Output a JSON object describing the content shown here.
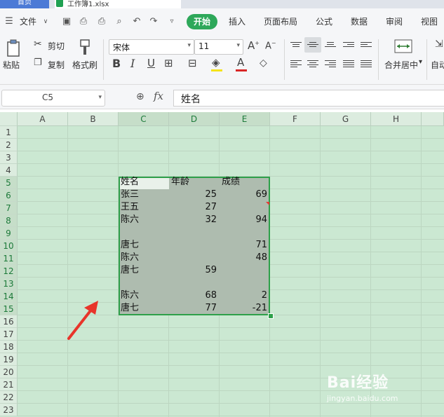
{
  "tabs": {
    "home": "首页",
    "file": "工作簿1.xlsx"
  },
  "menu": {
    "file": "文件",
    "items": [
      "开始",
      "插入",
      "页面布局",
      "公式",
      "数据",
      "审阅",
      "视图"
    ]
  },
  "ribbon": {
    "paste": "粘贴",
    "cut": "剪切",
    "copy": "复制",
    "format_painter": "格式刷",
    "font_name": "宋体",
    "font_size": "11",
    "merge_center": "合并居中",
    "auto": "自动"
  },
  "formula_bar": {
    "cell_ref": "C5",
    "fx": "fx",
    "content": "姓名"
  },
  "columns": [
    "A",
    "B",
    "C",
    "D",
    "E",
    "F",
    "G",
    "H"
  ],
  "rows": [
    "1",
    "2",
    "3",
    "4",
    "5",
    "6",
    "7",
    "8",
    "9",
    "10",
    "11",
    "12",
    "13",
    "14",
    "15",
    "16",
    "17",
    "18",
    "19",
    "20",
    "21",
    "22",
    "23"
  ],
  "table": [
    [
      "姓名",
      "年龄",
      "成绩"
    ],
    [
      "张三",
      "25",
      "69"
    ],
    [
      "王五",
      "27",
      ""
    ],
    [
      "陈六",
      "32",
      "94"
    ],
    [
      "",
      "",
      ""
    ],
    [
      "唐七",
      "",
      "71"
    ],
    [
      "陈六",
      "",
      "48"
    ],
    [
      "唐七",
      "59",
      ""
    ],
    [
      "",
      "",
      ""
    ],
    [
      "陈六",
      "68",
      "2"
    ],
    [
      "唐七",
      "77",
      "-21"
    ]
  ],
  "watermark": {
    "brand": "Bai经验",
    "url": "jingyan.baidu.com"
  },
  "colors": {
    "accent": "#2ea85a",
    "grid_bg": "#cbe8d2",
    "selection": "#aebcaf",
    "arrow": "#e8342a"
  }
}
